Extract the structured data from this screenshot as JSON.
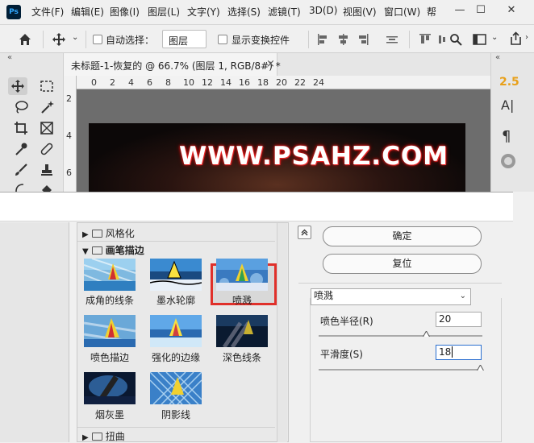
{
  "app": {
    "logo": "Ps"
  },
  "menubar": {
    "items": [
      "文件(F)",
      "编辑(E)",
      "图像(I)",
      "图层(L)",
      "文字(Y)",
      "选择(S)",
      "滤镜(T)",
      "3D(D)",
      "视图(V)",
      "窗口(W)",
      "帮"
    ],
    "window_buttons": [
      "—",
      "☐",
      "✕"
    ]
  },
  "options": {
    "auto_select_label": "自动选择：",
    "layer_dropdown": "图层",
    "show_transform_label": "显示变换控件"
  },
  "document": {
    "tab_title": "未标题-1-恢复的 @ 66.7% (图层 1, RGB/8#) *",
    "close": "×",
    "ruler_h": [
      "0",
      "2",
      "4",
      "6",
      "8",
      "10",
      "12",
      "14",
      "16",
      "18",
      "20",
      "22",
      "24"
    ],
    "ruler_v": [
      "2",
      "4",
      "6"
    ],
    "watermark": "WWW.PSAHZ.COM"
  },
  "rightstrip": {
    "char_panel_value": "2.5",
    "a_glyph": "A|",
    "para_glyph": "¶"
  },
  "filter_gallery": {
    "categories": {
      "stylize": "风格化",
      "brush_strokes": "画笔描边",
      "distort": "扭曲"
    },
    "thumbnails": [
      "成角的线条",
      "墨水轮廓",
      "喷溅",
      "喷色描边",
      "强化的边缘",
      "深色线条",
      "烟灰墨",
      "阴影线"
    ],
    "selected": "喷溅",
    "ok": "确定",
    "reset": "复位",
    "filter_select": "喷溅",
    "params": [
      {
        "label": "喷色半径(R)",
        "value": "20",
        "level": 0.67
      },
      {
        "label": "平滑度(S)",
        "value": "18",
        "level": 1.0
      }
    ]
  },
  "colors": {
    "selection_border": "#e0302a",
    "accent": "#e8a01a"
  }
}
